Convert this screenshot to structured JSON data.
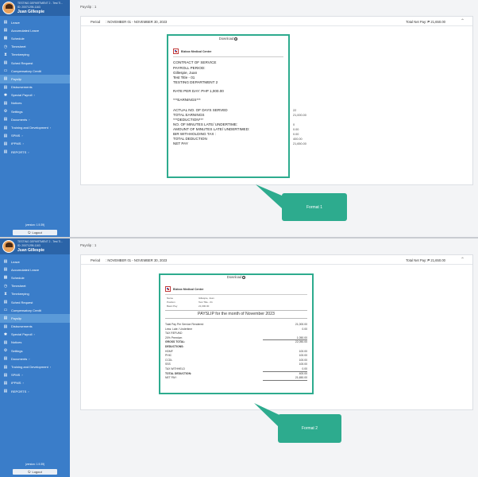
{
  "sidebar": {
    "user": {
      "department": "TESTING DEPARTMENT 2 - Test Ti...",
      "id": "ID: 20071295-1163",
      "name": "Juan Gillespie"
    },
    "items": [
      {
        "label": "Leave",
        "icon": "leave-icon",
        "glyph": "▤",
        "chev": ""
      },
      {
        "label": "Accumulated Leave",
        "icon": "accumulated-leave-icon",
        "glyph": "▤",
        "chev": ""
      },
      {
        "label": "Schedule",
        "icon": "calendar-icon",
        "glyph": "▦",
        "chev": ""
      },
      {
        "label": "Timesheet",
        "icon": "clock-icon",
        "glyph": "◷",
        "chev": ""
      },
      {
        "label": "Timekeeping",
        "icon": "hourglass-icon",
        "glyph": "⧗",
        "chev": ""
      },
      {
        "label": "Sched Request",
        "icon": "sched-request-icon",
        "glyph": "▤",
        "chev": ""
      },
      {
        "label": "Compensatory Credit",
        "icon": "credit-icon",
        "glyph": "▭",
        "chev": ""
      },
      {
        "label": "Payslip",
        "icon": "payslip-icon",
        "glyph": "▤",
        "chev": ""
      },
      {
        "label": "Disbursements",
        "icon": "disbursement-icon",
        "glyph": "▤",
        "chev": ""
      },
      {
        "label": "Special Payroll",
        "icon": "gear-icon",
        "glyph": "✱",
        "chev": "›"
      },
      {
        "label": "Notices",
        "icon": "notices-icon",
        "glyph": "▤",
        "chev": ""
      },
      {
        "label": "Settings",
        "icon": "settings-icon",
        "glyph": "⚙",
        "chev": ""
      },
      {
        "label": "Documents",
        "icon": "documents-icon",
        "glyph": "▤",
        "chev": "›"
      },
      {
        "label": "Training and Development",
        "icon": "training-icon",
        "glyph": "▤",
        "chev": "›"
      },
      {
        "label": "SPMS",
        "icon": "spms-icon",
        "glyph": "▤",
        "chev": "›"
      },
      {
        "label": "IPPMS",
        "icon": "ippms-icon",
        "glyph": "▤",
        "chev": "›"
      },
      {
        "label": "REPORTS",
        "icon": "reports-icon",
        "glyph": "▤",
        "chev": "›"
      }
    ],
    "version": "(version: 1.9.39)",
    "logout": "Logout"
  },
  "main": {
    "payslip_count": "Payslip : 1",
    "period_label": "Period",
    "period_value": ": NOVEMBER 01 - NOVEMBER 30, 2023",
    "net_pay": "Total Net Pay: ₱ 21,650.00",
    "download": "Download"
  },
  "company": "Bizbox Medical Center",
  "format1": {
    "lines": [
      "CONTRACT OF SERVICE",
      "PAYROLL PERIOD:",
      "Gillespie, Juan",
      "Test Title - 01",
      "TESTING DEPARTMENT 2",
      "RATE PER DAY: PHP 1,000.00",
      "***EARNINGS***",
      "ACTUAL NO. OF DAYS SERVED",
      "TOTAL EARNINGS",
      "***DEDUCTION***",
      "NO. OF MINUTES LATE/ UNDERTIME:",
      "AMOUNT OF MINUTES LATE/ UNDERTIMED:",
      "BIR WITHHOLDING TAX :",
      "TOTAL DEDUCTION",
      "NET PAY"
    ],
    "values": [
      {
        "row": 7,
        "value": "22"
      },
      {
        "row": 8,
        "value": "21,000.00"
      },
      {
        "row": 10,
        "value": "0"
      },
      {
        "row": 11,
        "value": "0.00"
      },
      {
        "row": 12,
        "value": "0.00"
      },
      {
        "row": 13,
        "value": "400.00"
      },
      {
        "row": 14,
        "value": "21,650.00"
      }
    ],
    "callout": "Format 1"
  },
  "format2": {
    "info": [
      {
        "label": "Name",
        "value": "Gillespie, Juan"
      },
      {
        "label": "Position",
        "value": "Test Title - 01"
      },
      {
        "label": "Basic Pay",
        "value": "21,000.00"
      }
    ],
    "title": "PAYSLIP for the month of November 2023",
    "rows": [
      {
        "label": "Total Pay Per Service Rendered",
        "value": "21,000.00",
        "bold": false,
        "sep": false
      },
      {
        "label": "Less: Late / Undertime",
        "value": "0.00",
        "bold": false,
        "sep": false
      },
      {
        "label": "TAX REFUND",
        "value": "",
        "bold": false,
        "sep": false
      },
      {
        "label": "20% Premium",
        "value": "1,050.00",
        "bold": false,
        "sep": true
      },
      {
        "label": "GROSS TOTAL:",
        "value": "22,050.00",
        "bold": true,
        "sep": false
      },
      {
        "label": "DEDUCTIONS:",
        "value": "",
        "bold": true,
        "sep": false
      },
      {
        "label": "HDMF",
        "value": "100.00",
        "bold": false,
        "sep": false
      },
      {
        "label": "PHIC",
        "value": "100.00",
        "bold": false,
        "sep": false
      },
      {
        "label": "CCDL",
        "value": "100.00",
        "bold": false,
        "sep": false
      },
      {
        "label": "SSS",
        "value": "100.00",
        "bold": false,
        "sep": false
      },
      {
        "label": "TAX WITHHELD",
        "value": "0.00",
        "bold": false,
        "sep": true
      },
      {
        "label": "TOTAL DEDUCTION:",
        "value": "400.00",
        "bold": true,
        "sep": false
      },
      {
        "label": "NET PAY:",
        "value": "21,650.00",
        "bold": false,
        "sep": true
      }
    ],
    "callout": "Format 2"
  },
  "colors": {
    "sidebar": "#3a7dc9",
    "sidebar_active": "#5b9ad8",
    "accent": "#2dab8e"
  }
}
